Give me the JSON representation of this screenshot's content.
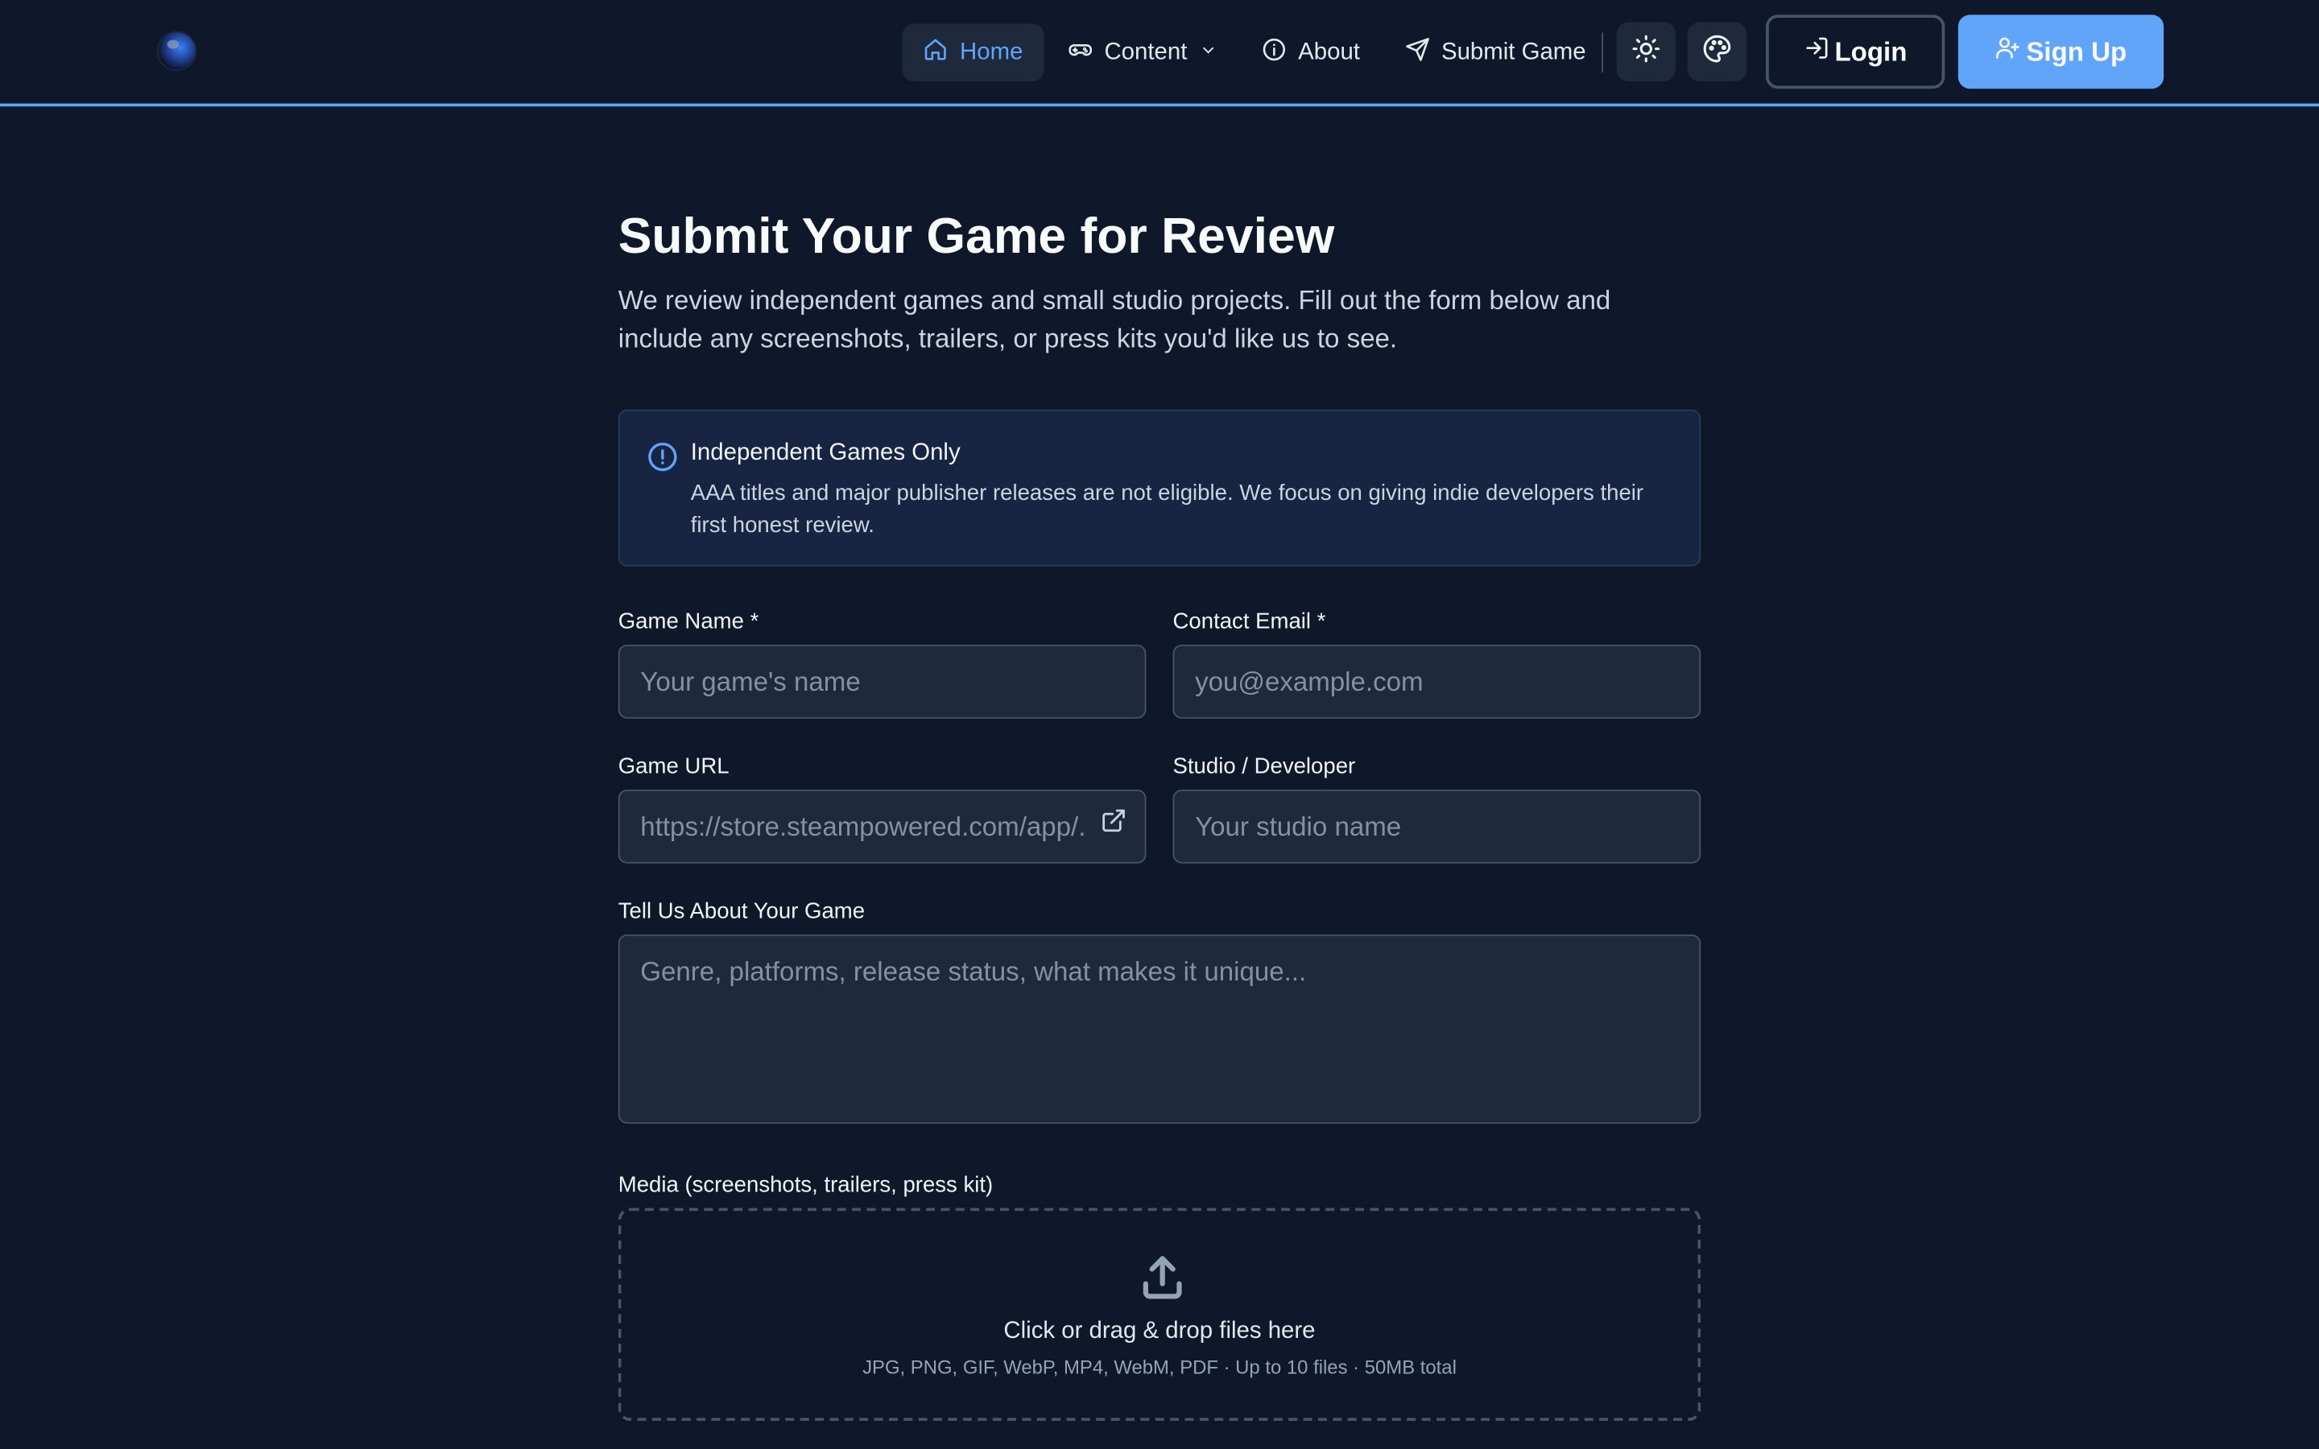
{
  "nav": {
    "items": [
      {
        "label": "Home",
        "icon": "home-icon",
        "active": true
      },
      {
        "label": "Content",
        "icon": "gamepad-icon",
        "dropdown": true
      },
      {
        "label": "About",
        "icon": "info-icon"
      },
      {
        "label": "Submit Game",
        "icon": "send-icon"
      }
    ],
    "theme_toggle_icon": "sun-icon",
    "palette_icon": "palette-icon",
    "login_label": "Login",
    "signup_label": "Sign Up"
  },
  "page": {
    "title": "Submit Your Game for Review",
    "lead": "We review independent games and small studio projects. Fill out the form below and include any screenshots, trailers, or press kits you'd like us to see."
  },
  "notice": {
    "title": "Independent Games Only",
    "body": "AAA titles and major publisher releases are not eligible. We focus on giving indie developers their first honest review."
  },
  "form": {
    "game_name": {
      "label": "Game Name *",
      "placeholder": "Your game's name",
      "value": ""
    },
    "contact_email": {
      "label": "Contact Email *",
      "placeholder": "you@example.com",
      "value": ""
    },
    "game_url": {
      "label": "Game URL",
      "placeholder": "https://store.steampowered.com/app/...",
      "value": ""
    },
    "studio": {
      "label": "Studio / Developer",
      "placeholder": "Your studio name",
      "value": ""
    },
    "about": {
      "label": "Tell Us About Your Game",
      "placeholder": "Genre, platforms, release status, what makes it unique...",
      "value": ""
    },
    "media": {
      "label": "Media (screenshots, trailers, press kit)",
      "drop_text": "Click or drag & drop files here",
      "drop_hint": "JPG, PNG, GIF, WebP, MP4, WebM, PDF · Up to 10 files · 50MB total"
    }
  },
  "colors": {
    "background": "#0f172a",
    "accent": "#60a5fa",
    "surface": "#1e293b",
    "notice_bg": "#172442"
  }
}
